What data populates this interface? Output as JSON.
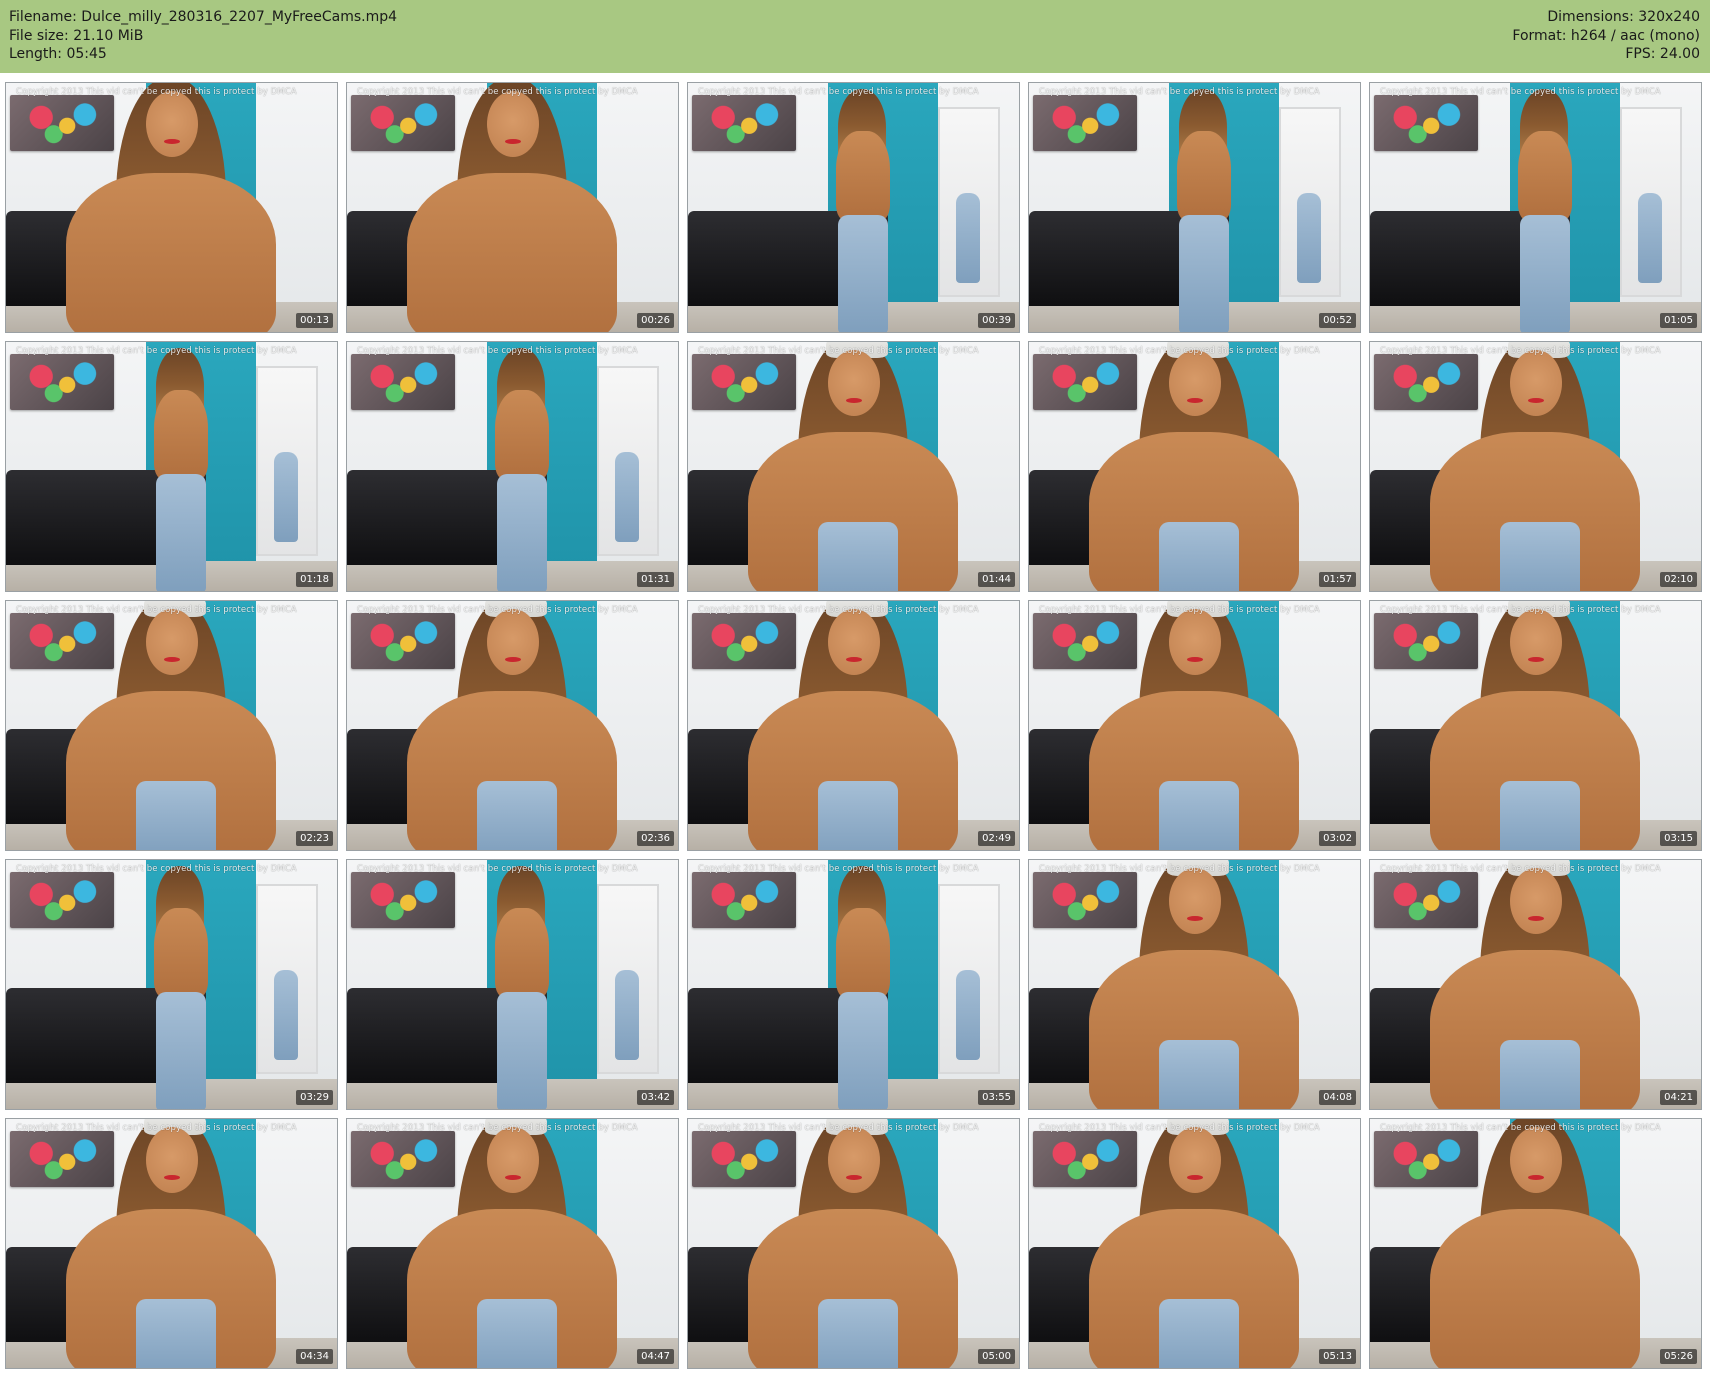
{
  "header": {
    "filename": "Filename: Dulce_milly_280316_2207_MyFreeCams.mp4",
    "filesize": "File size: 21.10 MiB",
    "length": "Length: 05:45",
    "dimensions": "Dimensions: 320x240",
    "format": "Format: h264 / aac (mono)",
    "fps": "FPS: 24.00"
  },
  "colors": {
    "header_bg": "#a8c882",
    "page_bg": "#ffffff"
  },
  "thumbnails": [
    {
      "time": "00:13",
      "scene": "closeup",
      "watermark": "Copyright 2013 This vid can't be copyed this is protect by DMCA"
    },
    {
      "time": "00:26",
      "scene": "closeup",
      "watermark": "Copyright 2013 This vid can't be copyed this is protect by DMCA"
    },
    {
      "time": "00:39",
      "scene": "standing",
      "watermark": "Copyright 2013 This vid can't be copyed this is protect by DMCA"
    },
    {
      "time": "00:52",
      "scene": "mirror",
      "watermark": "Copyright 2013 This vid can't be copyed this is protect by DMCA"
    },
    {
      "time": "01:05",
      "scene": "mirror",
      "watermark": "Copyright 2013 This vid can't be copyed this is protect by DMCA"
    },
    {
      "time": "01:18",
      "scene": "mirror",
      "watermark": "Copyright 2013 This vid can't be copyed this is protect by DMCA"
    },
    {
      "time": "01:31",
      "scene": "mirror",
      "watermark": "Copyright 2013 This vid can't be copyed this is protect by DMCA"
    },
    {
      "time": "01:44",
      "scene": "leaning",
      "watermark": "Copyright 2013 This vid can't be copyed this is protect by DMCA"
    },
    {
      "time": "01:57",
      "scene": "leaning",
      "watermark": "Copyright 2013 This vid can't be copyed this is protect by DMCA"
    },
    {
      "time": "02:10",
      "scene": "leaning",
      "watermark": "Copyright 2013 This vid can't be copyed this is protect by DMCA"
    },
    {
      "time": "02:23",
      "scene": "leaning",
      "watermark": "Copyright 2013 This vid can't be copyed this is protect by DMCA"
    },
    {
      "time": "02:36",
      "scene": "leaning",
      "watermark": "Copyright 2013 This vid can't be copyed this is protect by DMCA"
    },
    {
      "time": "02:49",
      "scene": "leaning",
      "watermark": "Copyright 2013 This vid can't be copyed this is protect by DMCA"
    },
    {
      "time": "03:02",
      "scene": "leaning",
      "watermark": "Copyright 2013 This vid can't be copyed this is protect by DMCA"
    },
    {
      "time": "03:15",
      "scene": "leaning",
      "watermark": "Copyright 2013 This vid can't be copyed this is protect by DMCA"
    },
    {
      "time": "03:29",
      "scene": "mirror",
      "watermark": "Copyright 2013 This vid can't be copyed this is protect by DMCA"
    },
    {
      "time": "03:42",
      "scene": "mirror",
      "watermark": "Copyright 2013 This vid can't be copyed this is protect by DMCA"
    },
    {
      "time": "03:55",
      "scene": "mirror",
      "watermark": "Copyright 2013 This vid can't be copyed this is protect by DMCA"
    },
    {
      "time": "04:08",
      "scene": "leaning",
      "watermark": "Copyright 2013 This vid can't be copyed this is protect by DMCA"
    },
    {
      "time": "04:21",
      "scene": "leaning",
      "watermark": "Copyright 2013 This vid can't be copyed this is protect by DMCA"
    },
    {
      "time": "04:34",
      "scene": "leaning",
      "watermark": "Copyright 2013 This vid can't be copyed this is protect by DMCA"
    },
    {
      "time": "04:47",
      "scene": "leaning",
      "watermark": "Copyright 2013 This vid can't be copyed this is protect by DMCA"
    },
    {
      "time": "05:00",
      "scene": "leaning",
      "watermark": "Copyright 2013 This vid can't be copyed this is protect by DMCA"
    },
    {
      "time": "05:13",
      "scene": "leaning",
      "watermark": "Copyright 2013 This vid can't be copyed this is protect by DMCA"
    },
    {
      "time": "05:26",
      "scene": "closeup",
      "watermark": "Copyright 2013 This vid can't be copyed this is protect by DMCA"
    }
  ]
}
